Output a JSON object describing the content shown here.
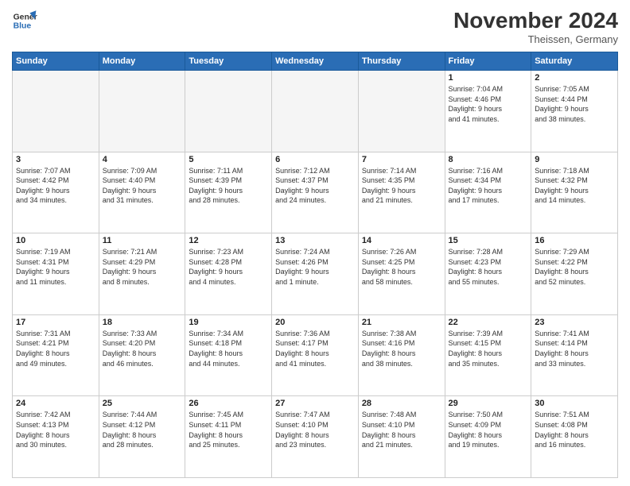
{
  "header": {
    "logo_line1": "General",
    "logo_line2": "Blue",
    "month": "November 2024",
    "location": "Theissen, Germany"
  },
  "weekdays": [
    "Sunday",
    "Monday",
    "Tuesday",
    "Wednesday",
    "Thursday",
    "Friday",
    "Saturday"
  ],
  "weeks": [
    [
      {
        "day": "",
        "info": ""
      },
      {
        "day": "",
        "info": ""
      },
      {
        "day": "",
        "info": ""
      },
      {
        "day": "",
        "info": ""
      },
      {
        "day": "",
        "info": ""
      },
      {
        "day": "1",
        "info": "Sunrise: 7:04 AM\nSunset: 4:46 PM\nDaylight: 9 hours\nand 41 minutes."
      },
      {
        "day": "2",
        "info": "Sunrise: 7:05 AM\nSunset: 4:44 PM\nDaylight: 9 hours\nand 38 minutes."
      }
    ],
    [
      {
        "day": "3",
        "info": "Sunrise: 7:07 AM\nSunset: 4:42 PM\nDaylight: 9 hours\nand 34 minutes."
      },
      {
        "day": "4",
        "info": "Sunrise: 7:09 AM\nSunset: 4:40 PM\nDaylight: 9 hours\nand 31 minutes."
      },
      {
        "day": "5",
        "info": "Sunrise: 7:11 AM\nSunset: 4:39 PM\nDaylight: 9 hours\nand 28 minutes."
      },
      {
        "day": "6",
        "info": "Sunrise: 7:12 AM\nSunset: 4:37 PM\nDaylight: 9 hours\nand 24 minutes."
      },
      {
        "day": "7",
        "info": "Sunrise: 7:14 AM\nSunset: 4:35 PM\nDaylight: 9 hours\nand 21 minutes."
      },
      {
        "day": "8",
        "info": "Sunrise: 7:16 AM\nSunset: 4:34 PM\nDaylight: 9 hours\nand 17 minutes."
      },
      {
        "day": "9",
        "info": "Sunrise: 7:18 AM\nSunset: 4:32 PM\nDaylight: 9 hours\nand 14 minutes."
      }
    ],
    [
      {
        "day": "10",
        "info": "Sunrise: 7:19 AM\nSunset: 4:31 PM\nDaylight: 9 hours\nand 11 minutes."
      },
      {
        "day": "11",
        "info": "Sunrise: 7:21 AM\nSunset: 4:29 PM\nDaylight: 9 hours\nand 8 minutes."
      },
      {
        "day": "12",
        "info": "Sunrise: 7:23 AM\nSunset: 4:28 PM\nDaylight: 9 hours\nand 4 minutes."
      },
      {
        "day": "13",
        "info": "Sunrise: 7:24 AM\nSunset: 4:26 PM\nDaylight: 9 hours\nand 1 minute."
      },
      {
        "day": "14",
        "info": "Sunrise: 7:26 AM\nSunset: 4:25 PM\nDaylight: 8 hours\nand 58 minutes."
      },
      {
        "day": "15",
        "info": "Sunrise: 7:28 AM\nSunset: 4:23 PM\nDaylight: 8 hours\nand 55 minutes."
      },
      {
        "day": "16",
        "info": "Sunrise: 7:29 AM\nSunset: 4:22 PM\nDaylight: 8 hours\nand 52 minutes."
      }
    ],
    [
      {
        "day": "17",
        "info": "Sunrise: 7:31 AM\nSunset: 4:21 PM\nDaylight: 8 hours\nand 49 minutes."
      },
      {
        "day": "18",
        "info": "Sunrise: 7:33 AM\nSunset: 4:20 PM\nDaylight: 8 hours\nand 46 minutes."
      },
      {
        "day": "19",
        "info": "Sunrise: 7:34 AM\nSunset: 4:18 PM\nDaylight: 8 hours\nand 44 minutes."
      },
      {
        "day": "20",
        "info": "Sunrise: 7:36 AM\nSunset: 4:17 PM\nDaylight: 8 hours\nand 41 minutes."
      },
      {
        "day": "21",
        "info": "Sunrise: 7:38 AM\nSunset: 4:16 PM\nDaylight: 8 hours\nand 38 minutes."
      },
      {
        "day": "22",
        "info": "Sunrise: 7:39 AM\nSunset: 4:15 PM\nDaylight: 8 hours\nand 35 minutes."
      },
      {
        "day": "23",
        "info": "Sunrise: 7:41 AM\nSunset: 4:14 PM\nDaylight: 8 hours\nand 33 minutes."
      }
    ],
    [
      {
        "day": "24",
        "info": "Sunrise: 7:42 AM\nSunset: 4:13 PM\nDaylight: 8 hours\nand 30 minutes."
      },
      {
        "day": "25",
        "info": "Sunrise: 7:44 AM\nSunset: 4:12 PM\nDaylight: 8 hours\nand 28 minutes."
      },
      {
        "day": "26",
        "info": "Sunrise: 7:45 AM\nSunset: 4:11 PM\nDaylight: 8 hours\nand 25 minutes."
      },
      {
        "day": "27",
        "info": "Sunrise: 7:47 AM\nSunset: 4:10 PM\nDaylight: 8 hours\nand 23 minutes."
      },
      {
        "day": "28",
        "info": "Sunrise: 7:48 AM\nSunset: 4:10 PM\nDaylight: 8 hours\nand 21 minutes."
      },
      {
        "day": "29",
        "info": "Sunrise: 7:50 AM\nSunset: 4:09 PM\nDaylight: 8 hours\nand 19 minutes."
      },
      {
        "day": "30",
        "info": "Sunrise: 7:51 AM\nSunset: 4:08 PM\nDaylight: 8 hours\nand 16 minutes."
      }
    ]
  ]
}
